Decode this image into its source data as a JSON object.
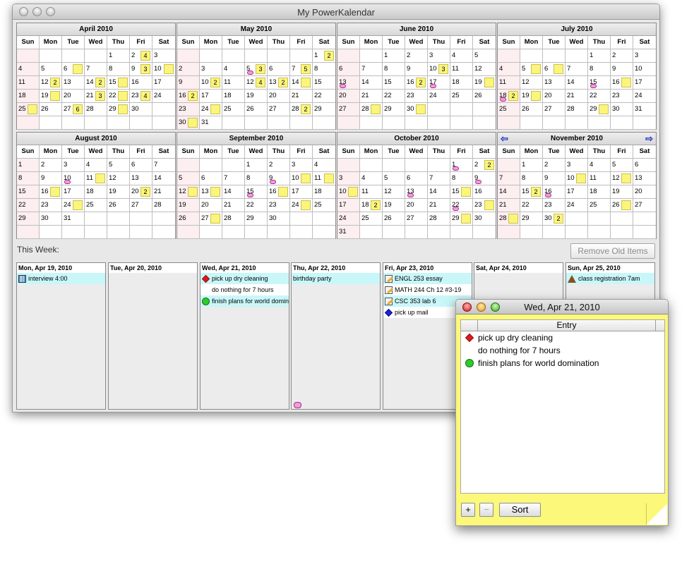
{
  "window": {
    "title": "My PowerKalendar"
  },
  "weekdays": [
    "Sun",
    "Mon",
    "Tue",
    "Wed",
    "Thu",
    "Fri",
    "Sat"
  ],
  "months": [
    {
      "title": "April 2010",
      "offset": 4,
      "days": 30,
      "marks": {
        "2": "4",
        "6": "n",
        "9": "3",
        "10": "n",
        "12": "2",
        "14": "2",
        "15": "n",
        "19": "n",
        "21": "3",
        "22": "n",
        "23": "4",
        "25": "n",
        "27": "6",
        "29": "n"
      }
    },
    {
      "title": "May 2010",
      "offset": 6,
      "days": 31,
      "marks": {
        "1": "2",
        "5": "c3",
        "7": "5",
        "10": "2",
        "12": "4",
        "13": "2",
        "14": "n",
        "16": "2",
        "24": "n",
        "28": "2",
        "30": "n"
      }
    },
    {
      "title": "June 2010",
      "offset": 2,
      "days": 30,
      "marks": {
        "10": "3",
        "13": "c",
        "16": "2",
        "17": "c",
        "19": "n",
        "28": "n",
        "30": "n"
      }
    },
    {
      "title": "July 2010",
      "offset": 4,
      "days": 31,
      "marks": {
        "5": "n",
        "6": "n",
        "15": "c",
        "16": "n",
        "18": "c2",
        "19": "n",
        "29": "n"
      }
    },
    {
      "title": "August 2010",
      "offset": 0,
      "days": 31,
      "marks": {
        "10": "c",
        "11": "n",
        "16": "n",
        "20": "2",
        "24": "n"
      }
    },
    {
      "title": "September 2010",
      "offset": 3,
      "days": 30,
      "marks": {
        "9": "c",
        "10": "n",
        "11": "n",
        "12": "n",
        "13": "n",
        "15": "c",
        "16": "n",
        "24": "n",
        "27": "n"
      }
    },
    {
      "title": "October 2010",
      "offset": 5,
      "days": 31,
      "marks": {
        "1": "c",
        "2": "2",
        "9": "c",
        "10": "n",
        "13": "c",
        "15": "n",
        "18": "2",
        "22": "c",
        "23": "n",
        "29": "n"
      }
    },
    {
      "title": "November 2010",
      "offset": 1,
      "days": 30,
      "marks": {
        "10": "n",
        "12": "n",
        "15": "2",
        "16": "c",
        "26": "n",
        "28": "n",
        "30": "2"
      },
      "nav": true
    }
  ],
  "this_week_label": "This Week:",
  "remove_button": "Remove Old Items",
  "week": [
    {
      "date": "Mon, Apr 19, 2010",
      "entries": [
        {
          "icon": "building",
          "text": "interview 4:00",
          "hl": true
        }
      ]
    },
    {
      "date": "Tue, Apr 20, 2010",
      "entries": []
    },
    {
      "date": "Wed, Apr 21, 2010",
      "entries": [
        {
          "icon": "diamond-red",
          "text": "pick up dry cleaning",
          "hl": true
        },
        {
          "icon": "none",
          "text": "do nothing for 7 hours",
          "hl": false
        },
        {
          "icon": "clover",
          "text": "finish plans for world domination",
          "hl": true
        }
      ]
    },
    {
      "date": "Thu, Apr 22, 2010",
      "entries": [
        {
          "icon": "cake",
          "text": "birthday party",
          "hl": true
        }
      ]
    },
    {
      "date": "Fri, Apr 23, 2010",
      "entries": [
        {
          "icon": "pencil",
          "text": "ENGL 253 essay",
          "hl": true
        },
        {
          "icon": "pencil",
          "text": "MATH 244 Ch 12 #3-19",
          "hl": false
        },
        {
          "icon": "pencil",
          "text": "CSC 353 lab 6",
          "hl": true
        },
        {
          "icon": "diamond-blue",
          "text": "pick up mail",
          "hl": false
        }
      ]
    },
    {
      "date": "Sat, Apr 24, 2010",
      "entries": []
    },
    {
      "date": "Sun, Apr 25, 2010",
      "entries": [
        {
          "icon": "house",
          "text": "class registration 7am",
          "hl": true
        }
      ]
    }
  ],
  "popup": {
    "title": "Wed, Apr 21, 2010",
    "column": "Entry",
    "entries": [
      {
        "icon": "diamond-red",
        "text": "pick up dry cleaning"
      },
      {
        "icon": "none",
        "text": "do nothing for 7 hours"
      },
      {
        "icon": "clover",
        "text": "finish plans for world domination"
      }
    ],
    "add": "+",
    "remove": "−",
    "sort": "Sort"
  }
}
